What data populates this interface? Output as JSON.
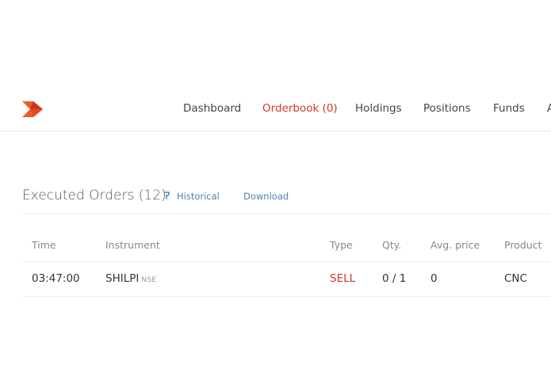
{
  "nav": {
    "items": [
      {
        "label": "Dashboard",
        "active": false
      },
      {
        "label": "Orderbook (0)",
        "active": true
      },
      {
        "label": "Holdings",
        "active": false
      },
      {
        "label": "Positions",
        "active": false
      },
      {
        "label": "Funds",
        "active": false
      },
      {
        "label": "A",
        "active": false
      }
    ]
  },
  "colors": {
    "accent": "#d43725",
    "logo_orange": "#f05a28",
    "logo_dark": "#c9391f",
    "link": "#4f82b5"
  },
  "executed": {
    "title": "Executed Orders (12)",
    "historical_icon": "clock-icon",
    "historical_label": "Historical",
    "download_label": "Download",
    "columns": [
      "Time",
      "Instrument",
      "Type",
      "Qty.",
      "Avg. price",
      "Product"
    ],
    "rows": [
      {
        "time": "03:47:00",
        "instrument": "SHILPI",
        "exchange": "NSE",
        "type": "SELL",
        "qty": "0 / 1",
        "avg_price": "0",
        "product": "CNC"
      }
    ]
  }
}
